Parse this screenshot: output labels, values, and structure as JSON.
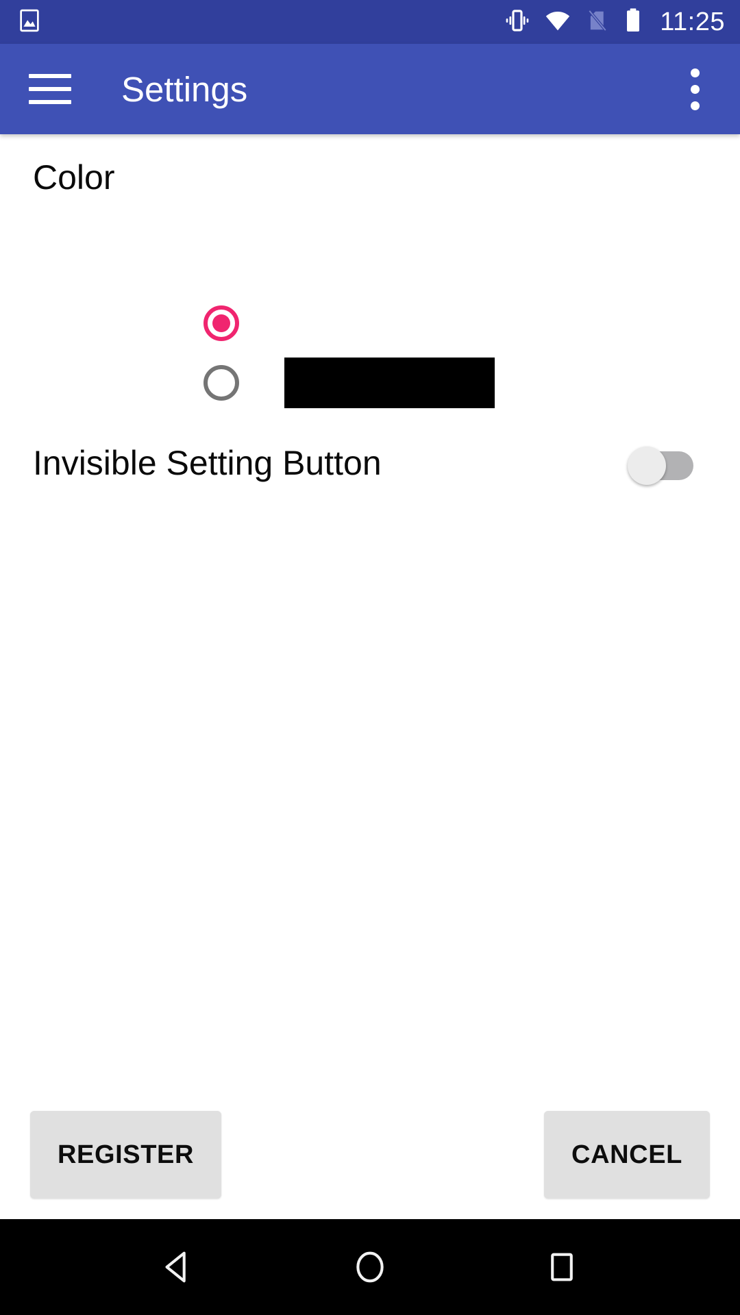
{
  "status_bar": {
    "notification_icon": "image-icon",
    "icons": [
      "vibrate-icon",
      "wifi-icon",
      "no-sim-icon",
      "battery-icon"
    ],
    "clock": "11:25",
    "background_color": "#313F9C",
    "foreground_color": "#FFFFFF"
  },
  "app_bar": {
    "menu_icon": "hamburger-menu-icon",
    "title": "Settings",
    "overflow_icon": "more-vertical-icon",
    "background_color": "#3F51B5",
    "title_color": "#FFFFFF"
  },
  "settings": {
    "color_group": {
      "label": "Color",
      "options": [
        {
          "id": "primary",
          "selected": true,
          "swatch": null,
          "accent_color": "#F0256F"
        },
        {
          "id": "custom",
          "selected": false,
          "swatch": "#000000",
          "outline_color": "#757575"
        }
      ]
    },
    "invisible_setting": {
      "label": "Invisible Setting Button",
      "switch_on": false,
      "track_color": "#B2B2B4",
      "thumb_color": "#ECECEC"
    }
  },
  "actions": {
    "register_label": "REGISTER",
    "cancel_label": "CANCEL",
    "button_color": "#E0E0E0",
    "button_text_color": "#0D0D0D"
  },
  "nav_bar": {
    "background_color": "#000000",
    "buttons": [
      {
        "name": "back-icon"
      },
      {
        "name": "home-icon"
      },
      {
        "name": "recents-icon"
      }
    ]
  }
}
